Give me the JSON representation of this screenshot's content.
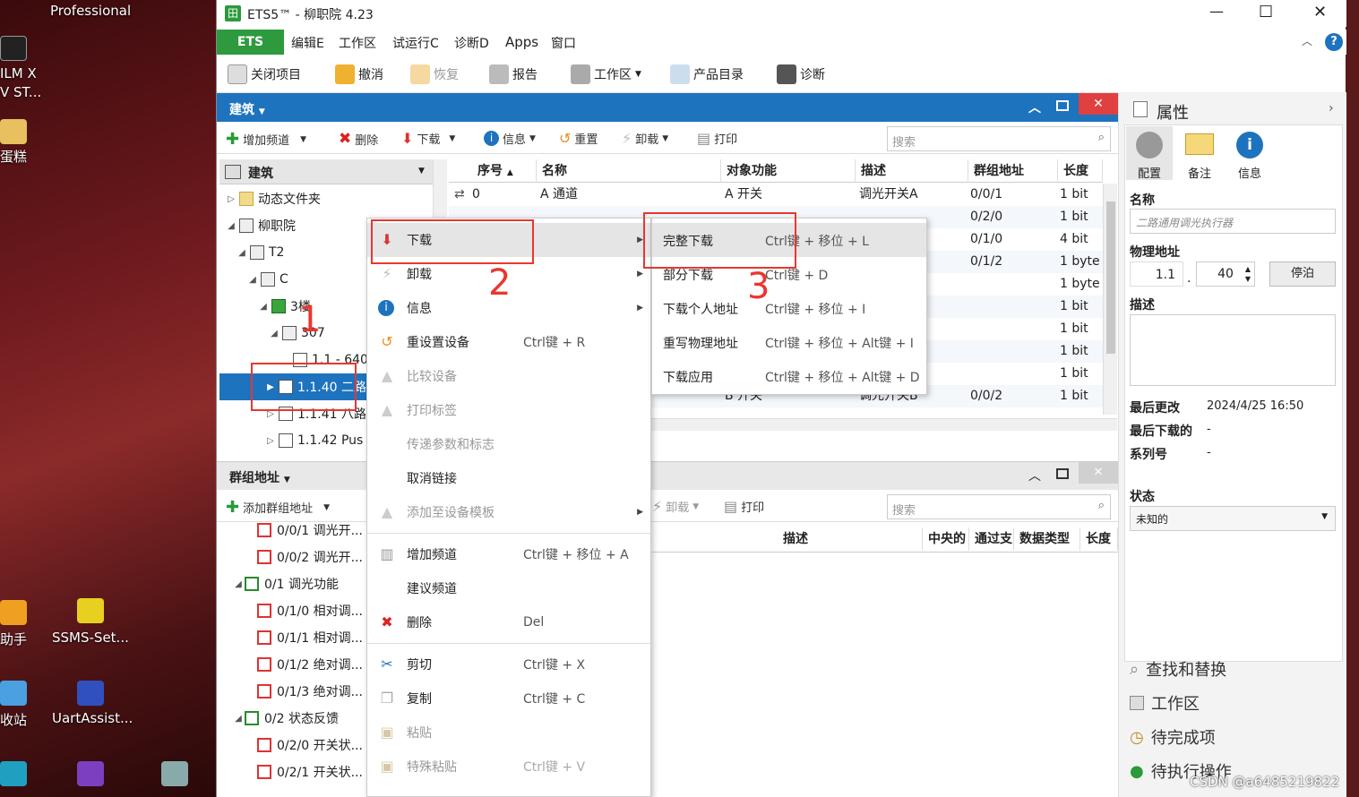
{
  "desktop": {
    "top_label": "Professional",
    "items": [
      {
        "label": "ILM X"
      },
      {
        "label": "V ST..."
      },
      {
        "label": "蛋糕"
      },
      {
        "label": "助手"
      },
      {
        "label": "SSMS-Set..."
      },
      {
        "label": "收站"
      },
      {
        "label": "UartAssist..."
      }
    ]
  },
  "window": {
    "title": "ETS5™ - 柳职院 4.23",
    "controls": {
      "minimize": "—",
      "maximize": "☐",
      "close": "✕"
    }
  },
  "menubar": {
    "ets_tab": "ETS",
    "items": [
      "编辑E",
      "工作区",
      "试运行C",
      "诊断D",
      "Apps",
      "窗口"
    ],
    "help": "?"
  },
  "toolbar": {
    "close_project": "关闭项目",
    "undo": "撤消",
    "redo": "恢复",
    "report": "报告",
    "workspace": "工作区",
    "catalog": "产品目录",
    "diagnostics": "诊断"
  },
  "building_panel": {
    "title": "建筑",
    "actions": {
      "add_channel": "增加频道",
      "delete": "删除",
      "download": "下载",
      "info": "信息",
      "reset": "重置",
      "unload": "卸载",
      "print": "打印"
    },
    "search_placeholder": "搜索",
    "tree_header": "建筑",
    "tree": [
      {
        "label": "动态文件夹"
      },
      {
        "label": "柳职院"
      },
      {
        "label": "T2"
      },
      {
        "label": "C"
      },
      {
        "label": "3楼"
      },
      {
        "label": "307"
      },
      {
        "label": "1.1 - 640m"
      },
      {
        "label": "1.1.40 二路"
      },
      {
        "label": "1.1.41 八路"
      },
      {
        "label": "1.1.42 Pus"
      }
    ],
    "table": {
      "headers": [
        "序号",
        "名称",
        "对象功能",
        "描述",
        "群组地址",
        "长度"
      ],
      "rows": [
        [
          "0",
          "A 通道",
          "A 开关",
          "调光开关A",
          "0/0/1",
          "1 bit"
        ],
        [
          "",
          "",
          "",
          "",
          "0/2/0",
          "1 bit"
        ],
        [
          "",
          "",
          "",
          "",
          "0/1/0",
          "4 bit"
        ],
        [
          "",
          "",
          "",
          "",
          "0/1/2",
          "1 byte"
        ],
        [
          "",
          "",
          "",
          "",
          "",
          "1 byte"
        ],
        [
          "",
          "",
          "",
          "",
          "",
          "1 bit"
        ],
        [
          "",
          "",
          "",
          "",
          "",
          "1 bit"
        ],
        [
          "",
          "",
          "",
          "",
          "",
          "1 bit"
        ],
        [
          "",
          "",
          "",
          "",
          "",
          "1 bit"
        ],
        [
          "",
          "",
          "B 开关",
          "调光开关B",
          "0/0/2",
          "1 bit"
        ]
      ]
    }
  },
  "group_panel": {
    "title": "群组地址",
    "add": "添加群组地址",
    "unload": "卸载",
    "print": "打印",
    "search_placeholder": "搜索",
    "headers": [
      "描述",
      "中央的",
      "通过支",
      "数据类型",
      "长度"
    ],
    "tree": [
      {
        "label": "0/0/1 调光开..."
      },
      {
        "label": "0/0/2 调光开..."
      },
      {
        "label": "0/1 调光功能"
      },
      {
        "label": "0/1/0 相对调..."
      },
      {
        "label": "0/1/1 相对调..."
      },
      {
        "label": "0/1/2 绝对调..."
      },
      {
        "label": "0/1/3 绝对调..."
      },
      {
        "label": "0/2 状态反馈"
      },
      {
        "label": "0/2/0 开关状..."
      },
      {
        "label": "0/2/1 开关状..."
      }
    ]
  },
  "context_menu": {
    "items": [
      {
        "label": "下载",
        "shortcut": ""
      },
      {
        "label": "卸载",
        "shortcut": ""
      },
      {
        "label": "信息",
        "shortcut": ""
      },
      {
        "label": "重设置设备",
        "shortcut": "Ctrl键 + R"
      },
      {
        "label": "比较设备",
        "shortcut": ""
      },
      {
        "label": "打印标签",
        "shortcut": ""
      },
      {
        "label": "传递参数和标志",
        "shortcut": ""
      },
      {
        "label": "取消链接",
        "shortcut": ""
      },
      {
        "label": "添加至设备模板",
        "shortcut": ""
      },
      {
        "label": "增加频道",
        "shortcut": "Ctrl键 + 移位 + A"
      },
      {
        "label": "建议频道",
        "shortcut": ""
      },
      {
        "label": "删除",
        "shortcut": "Del"
      },
      {
        "label": "剪切",
        "shortcut": "Ctrl键 + X"
      },
      {
        "label": "复制",
        "shortcut": "Ctrl键 + C"
      },
      {
        "label": "粘贴",
        "shortcut": ""
      },
      {
        "label": "特殊粘贴",
        "shortcut": "Ctrl键 + V"
      }
    ]
  },
  "submenu": {
    "items": [
      {
        "label": "完整下载",
        "shortcut": "Ctrl键 + 移位 + L"
      },
      {
        "label": "部分下载",
        "shortcut": "Ctrl键 + D"
      },
      {
        "label": "下载个人地址",
        "shortcut": "Ctrl键 + 移位 + I"
      },
      {
        "label": "重写物理地址",
        "shortcut": "Ctrl键 + 移位 + Alt键 + I"
      },
      {
        "label": "下载应用",
        "shortcut": "Ctrl键 + 移位 + Alt键 + D"
      }
    ]
  },
  "annotations": {
    "n1": "1",
    "n2": "2",
    "n3": "3"
  },
  "properties": {
    "title": "属性",
    "tabs": [
      "配置",
      "备注",
      "信息"
    ],
    "name_label": "名称",
    "name_value": "二路通用调光执行器",
    "phys_label": "物理地址",
    "phys_prefix": "1.1",
    "phys_dot": ".",
    "phys_value": "40",
    "park": "停泊",
    "desc_label": "描述",
    "last_change_label": "最后更改",
    "last_change_value": "2024/4/25 16:50",
    "last_download_label": "最后下载的",
    "last_download_value": "-",
    "serial_label": "系列号",
    "serial_value": "-",
    "status_label": "状态",
    "status_value": "未知的",
    "nav": [
      "查找和替换",
      "工作区",
      "待完成项",
      "待执行操作"
    ]
  },
  "watermark": "CSDN @a6485219822"
}
